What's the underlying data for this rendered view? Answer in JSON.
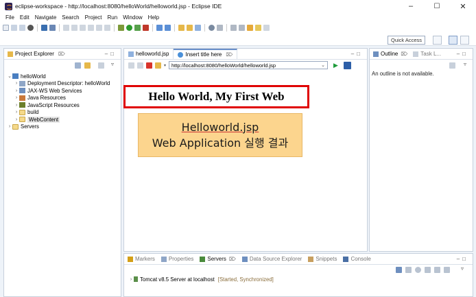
{
  "window": {
    "title": "eclipse-workspace - http://localhost:8080/helloWorld/helloworld.jsp - Eclipse IDE",
    "minimize": "–",
    "maximize": "☐",
    "close": "✕"
  },
  "menu": [
    "File",
    "Edit",
    "Navigate",
    "Search",
    "Project",
    "Run",
    "Window",
    "Help"
  ],
  "quick_access": {
    "label": "Quick Access"
  },
  "project_explorer": {
    "title": "Project Explorer",
    "close": "⌦",
    "tree": [
      {
        "twisty": "⌄",
        "label": "helloWorld",
        "icon": "project-icon",
        "indent": 0
      },
      {
        "twisty": "›",
        "label": "Deployment Descriptor: helloWorld",
        "icon": "descriptor-icon",
        "indent": 1
      },
      {
        "twisty": "›",
        "label": "JAX-WS Web Services",
        "icon": "webservice-icon",
        "indent": 1
      },
      {
        "twisty": "›",
        "label": "Java Resources",
        "icon": "java-resources-icon",
        "indent": 1
      },
      {
        "twisty": "›",
        "label": "JavaScript Resources",
        "icon": "js-resources-icon",
        "indent": 1
      },
      {
        "twisty": "›",
        "label": "build",
        "icon": "folder-icon",
        "indent": 1
      },
      {
        "twisty": "›",
        "label": "WebContent",
        "icon": "folder-icon",
        "indent": 1,
        "selected": true
      },
      {
        "twisty": "›",
        "label": "Servers",
        "icon": "folder-icon",
        "indent": 0
      }
    ]
  },
  "editor": {
    "tabs": [
      {
        "label": "helloworld.jsp",
        "active": false
      },
      {
        "label": "Insert title here",
        "active": true,
        "close": "⌦"
      }
    ],
    "url": "http://localhost:8080/helloWorld/helloworld.jsp",
    "page_heading": "Hello World, My First Web",
    "callout_line1": "Helloworld.jsp",
    "callout_line2": "Web Application 실행 결과"
  },
  "outline": {
    "title": "Outline",
    "second_tab": "Task L...",
    "message": "An outline is not available."
  },
  "bottom_panel": {
    "tabs": [
      "Markers",
      "Properties",
      "Servers",
      "Data Source Explorer",
      "Snippets",
      "Console"
    ],
    "active_tab": "Servers",
    "server_name": "Tomcat v8.5 Server at localhost",
    "server_status": "[Started, Synchronized]"
  },
  "colors": {
    "accent": "#e00000",
    "callout_bg": "#fcd58e",
    "status_text": "#8a6d3b"
  }
}
